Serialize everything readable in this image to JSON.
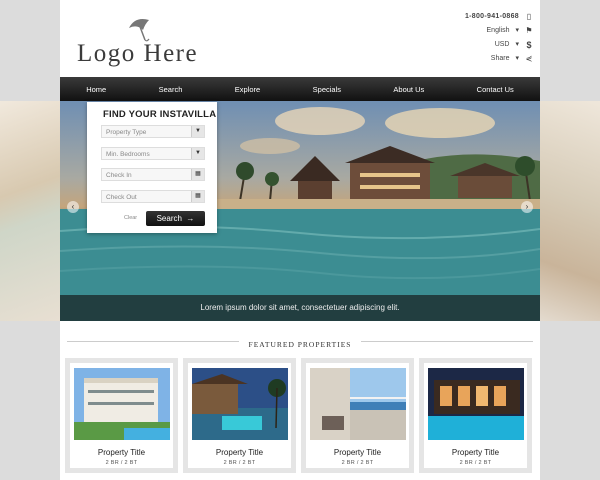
{
  "header": {
    "logo_text": "Logo Here",
    "phone": "1-800-941-0868",
    "language": "English",
    "currency": "USD",
    "share": "Share"
  },
  "nav": {
    "items": [
      "Home",
      "Search",
      "Explore",
      "Specials",
      "About Us",
      "Contact Us"
    ]
  },
  "hero": {
    "caption": "Lorem ipsum dolor sit amet, consectetuer adipiscing elit."
  },
  "search": {
    "title": "FIND YOUR INSTAVILLA",
    "property_type": "Property Type",
    "bedrooms": "Min. Bedrooms",
    "check_in": "Check In",
    "check_out": "Check Out",
    "clear": "Clear",
    "button": "Search"
  },
  "featured": {
    "title": "FEATURED PROPERTIES",
    "cards": [
      {
        "title": "Property Title",
        "meta": "2 BR / 2 BT"
      },
      {
        "title": "Property Title",
        "meta": "2 BR / 2 BT"
      },
      {
        "title": "Property Title",
        "meta": "2 BR / 2 BT"
      },
      {
        "title": "Property Title",
        "meta": "2 BR / 2 BT"
      }
    ]
  },
  "icons": {
    "logo": "umbrella-icon",
    "phone": "phone-icon",
    "language": "flag-icon",
    "currency": "dollar-icon",
    "share": "share-icon",
    "dropdown": "caret-down-icon",
    "calendar": "calendar-icon",
    "search_arrow": "arrow-right-icon",
    "hero_prev": "chevron-left-icon",
    "hero_next": "chevron-right-icon"
  }
}
